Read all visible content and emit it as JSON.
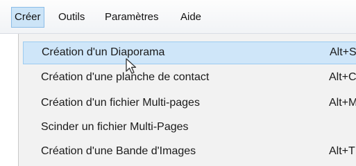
{
  "menubar": {
    "items": [
      {
        "label": "Créer",
        "active": true
      },
      {
        "label": "Outils"
      },
      {
        "label": "Paramètres"
      },
      {
        "label": "Aide"
      }
    ]
  },
  "dropdown": {
    "items": [
      {
        "label": "Création d'un Diaporama",
        "shortcut": "Alt+S",
        "highlighted": true
      },
      {
        "label": "Création d'une planche de contact",
        "shortcut": "Alt+C"
      },
      {
        "label": "Création d'un fichier Multi-pages",
        "shortcut": "Alt+M"
      },
      {
        "label": "Scinder un fichier Multi-Pages",
        "shortcut": ""
      },
      {
        "label": "Création d'une Bande d'Images",
        "shortcut": "Alt+T"
      }
    ]
  },
  "colors": {
    "highlight": "#cfe6f9",
    "highlight_border": "#9ccbf0",
    "menu_background": "#f2f2f2"
  },
  "icons": [
    "mouse-pointer-icon"
  ]
}
